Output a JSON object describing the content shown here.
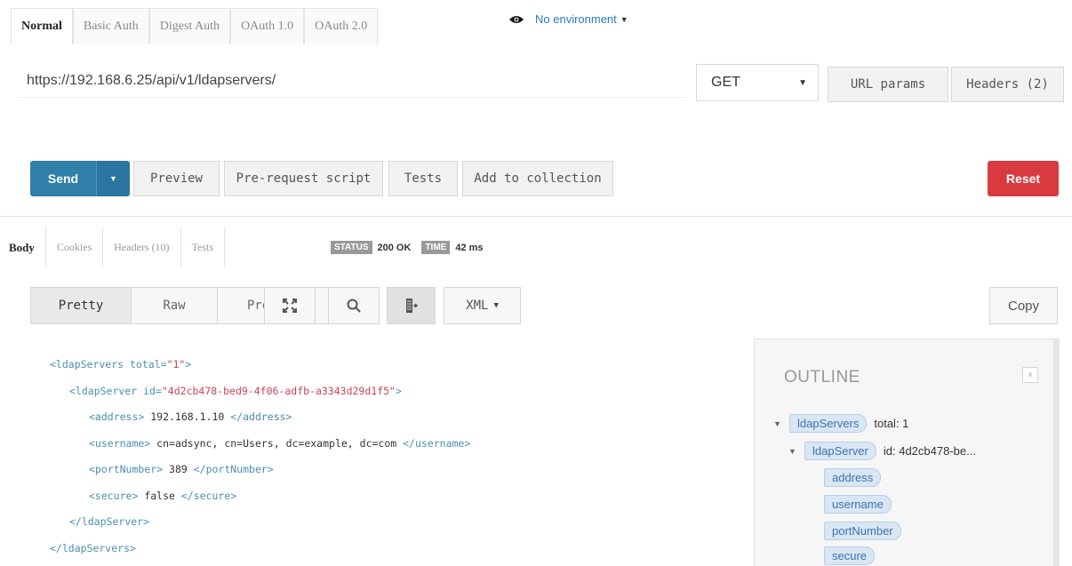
{
  "auth_tabs": [
    "Normal",
    "Basic Auth",
    "Digest Auth",
    "OAuth 1.0",
    "OAuth 2.0"
  ],
  "environment": {
    "label": "No environment",
    "icon": "eye-icon"
  },
  "request": {
    "url": "https://192.168.6.25/api/v1/ldapservers/",
    "method": "GET",
    "url_params_label": "URL params",
    "headers_label": "Headers (2)"
  },
  "actions": {
    "send": "Send",
    "preview": "Preview",
    "pre_request": "Pre-request script",
    "tests": "Tests",
    "add_to_collection": "Add to collection",
    "reset": "Reset"
  },
  "response": {
    "tabs": [
      "Body",
      "Cookies",
      "Headers (10)",
      "Tests"
    ],
    "status_label": "STATUS",
    "status_value": "200 OK",
    "time_label": "TIME",
    "time_value": "42 ms"
  },
  "viewer": {
    "tabs": [
      "Pretty",
      "Raw",
      "Preview"
    ],
    "format": "XML",
    "copy": "Copy"
  },
  "code": {
    "l1_open": "<ldapServers",
    "l1_attr": " total=",
    "l1_val": "\"1\"",
    "l1_close": ">",
    "l2_open": "<ldapServer",
    "l2_attr": " id=",
    "l2_val": "\"4d2cb478-bed9-4f06-adfb-a3343d29d1f5\"",
    "l2_close": ">",
    "l3_open": "<address>",
    "l3_text": " 192.168.1.10 ",
    "l3_close": "</address>",
    "l4_open": "<username>",
    "l4_text": " cn=adsync, cn=Users, dc=example, dc=com ",
    "l4_close": "</username>",
    "l5_open": "<portNumber>",
    "l5_text": " 389 ",
    "l5_close": "</portNumber>",
    "l6_open": "<secure>",
    "l6_text": " false ",
    "l6_close": "</secure>",
    "l7": "</ldapServer>",
    "l8": "</ldapServers>"
  },
  "outline": {
    "title": "OUTLINE",
    "close": "×",
    "nodes": [
      {
        "name": "ldapServers",
        "detail": "total: 1"
      },
      {
        "name": "ldapServer",
        "detail": "id: 4d2cb478-be..."
      },
      {
        "name": "address"
      },
      {
        "name": "username"
      },
      {
        "name": "portNumber"
      },
      {
        "name": "secure"
      }
    ]
  },
  "colors": {
    "send": "#2f7fa9",
    "reset": "#d93a3f",
    "link": "#2a78c9",
    "xml_tag": "#4a8fb0",
    "xml_value": "#c9445a"
  }
}
